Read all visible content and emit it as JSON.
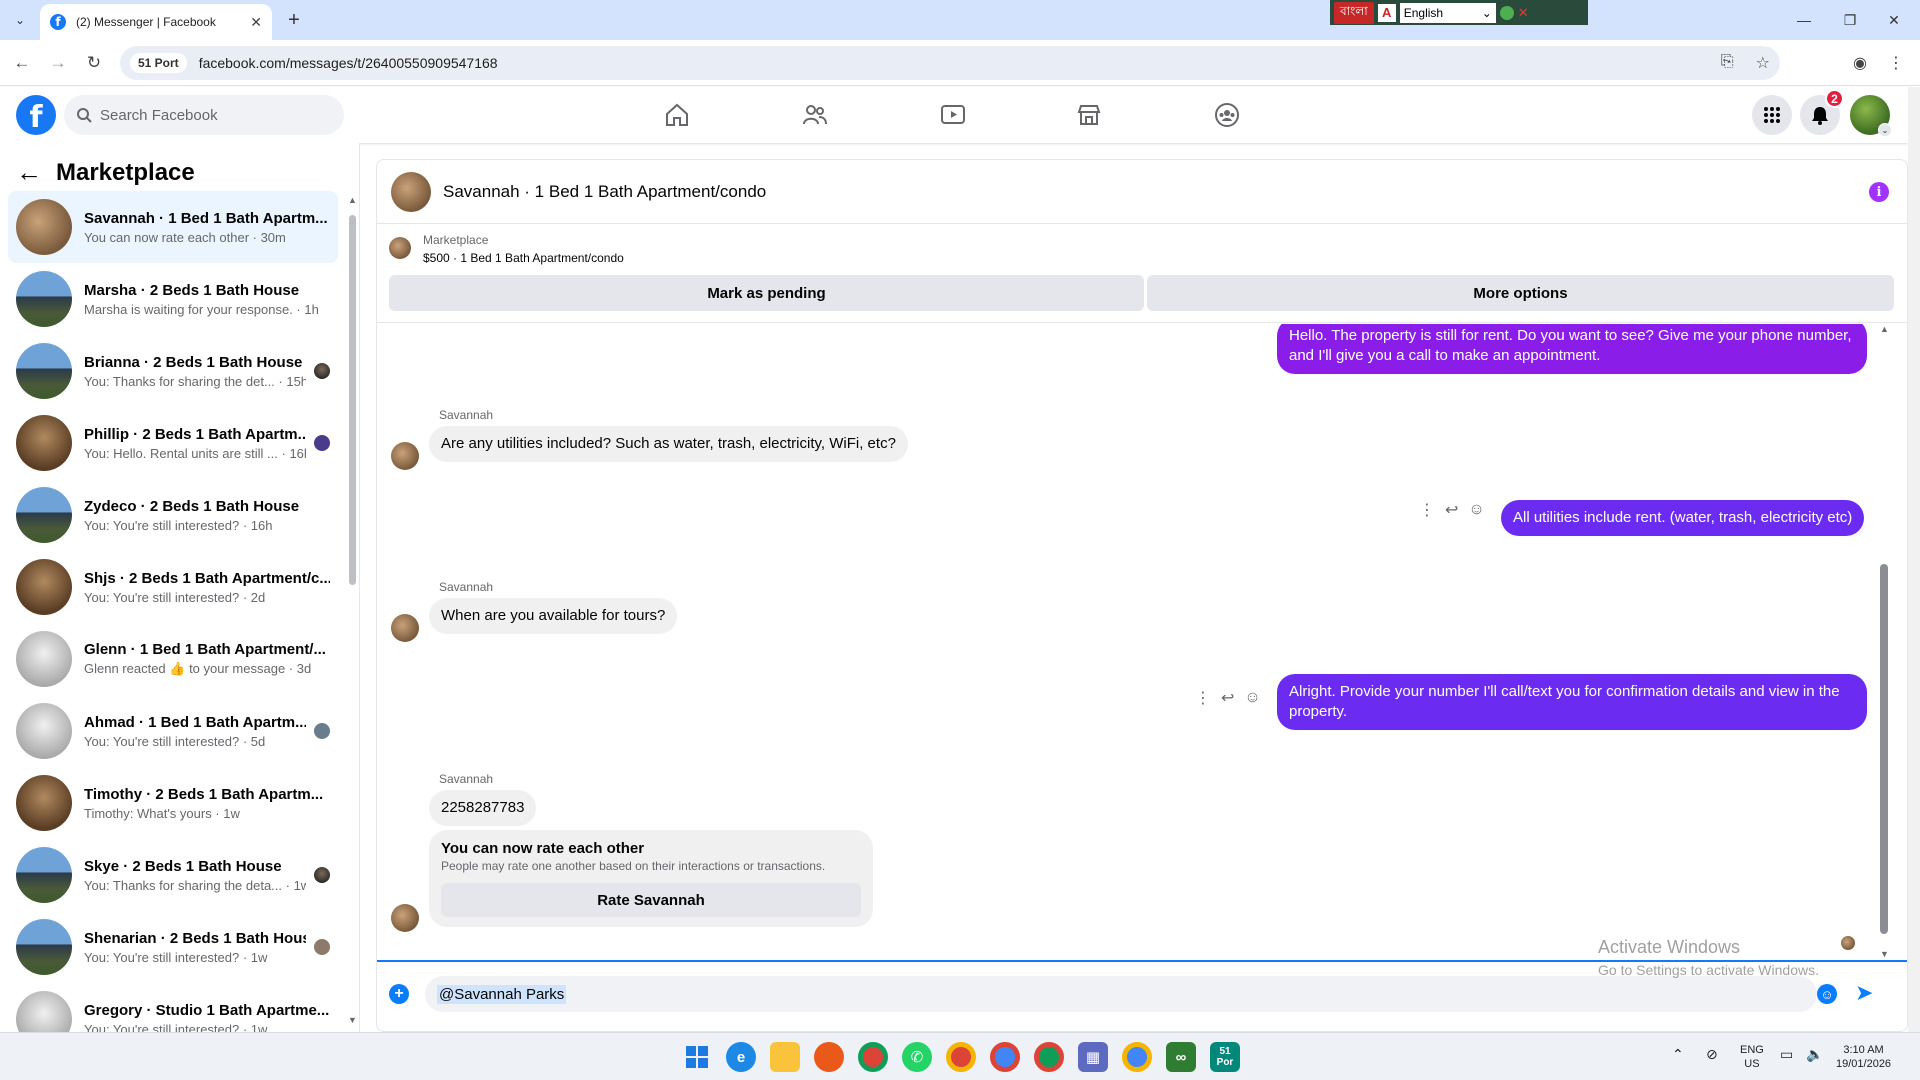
{
  "browser": {
    "tab_title": "(2) Messenger | Facebook",
    "site_chip": "51 Port",
    "url": "facebook.com/messages/t/26400550909547168",
    "langbar_bengali": "বাংলা",
    "langbar_language": "English"
  },
  "fb": {
    "search_placeholder": "Search Facebook",
    "notification_count": "2",
    "brand_color": "#1877f2"
  },
  "sidebar": {
    "title": "Marketplace",
    "conversations": [
      {
        "name": "Savannah · 1 Bed 1 Bath Apartm...",
        "sub": "You can now rate each other · 30m",
        "active": true
      },
      {
        "name": "Marsha · 2 Beds 1 Bath House",
        "sub": "Marsha is waiting for your response. · 1h"
      },
      {
        "name": "Brianna · 2 Beds 1 Bath House",
        "sub": "You: Thanks for sharing the det... · 15h"
      },
      {
        "name": "Phillip · 2 Beds 1 Bath Apartm...",
        "sub": "You: Hello. Rental units are still ... · 16h"
      },
      {
        "name": "Zydeco · 2 Beds 1 Bath House",
        "sub": "You: You're still interested? · 16h"
      },
      {
        "name": "Shjs · 2 Beds 1 Bath Apartment/c...",
        "sub": "You: You're still interested? · 2d"
      },
      {
        "name": "Glenn · 1 Bed 1 Bath Apartment/...",
        "sub": "Glenn reacted 👍 to your message · 3d"
      },
      {
        "name": "Ahmad · 1 Bed 1 Bath Apartm...",
        "sub": "You: You're still interested? · 5d"
      },
      {
        "name": "Timothy · 2 Beds 1 Bath Apartm...",
        "sub": "Timothy: What's yours · 1w"
      },
      {
        "name": "Skye · 2 Beds 1 Bath House",
        "sub": "You: Thanks for sharing the deta... · 1w"
      },
      {
        "name": "Shenarian · 2 Beds 1 Bath House",
        "sub": "You: You're still interested? · 1w"
      },
      {
        "name": "Gregory · Studio 1 Bath Apartme...",
        "sub": "You: You're still interested? · 1w"
      }
    ]
  },
  "chat": {
    "title": "Savannah · 1 Bed 1 Bath Apartment/condo",
    "marketplace_label": "Marketplace",
    "listing": "$500 · 1 Bed 1 Bath Apartment/condo",
    "mark_pending": "Mark as pending",
    "more_options": "More options",
    "messages": {
      "out1": "Hello. The property is still for rent. Do you want to see? Give me your phone number, and I'll give you a call to make an appointment.",
      "sender": "Savannah",
      "in1": "Are any utilities included? Such as water, trash, electricity, WiFi, etc?",
      "out2": "All utilities include rent. (water, trash, electricity etc)",
      "in2": "When are you available for tours?",
      "out3": "Alright. Provide your number I'll call/text you for confirmation details and view in the property.",
      "in3": "2258287783"
    },
    "rate_card": {
      "title": "You can now rate each other",
      "subtitle": "People may rate one another based on their interactions or transactions.",
      "button": "Rate Savannah"
    },
    "composer_value": "@Savannah Parks"
  },
  "watermark": {
    "line1": "Activate Windows",
    "line2": "Go to Settings to activate Windows."
  },
  "taskbar": {
    "lang1": "ENG",
    "lang2": "US",
    "time": "3:10 AM",
    "date": "19/01/2026",
    "port_label_1": "51",
    "port_label_2": "Por"
  }
}
